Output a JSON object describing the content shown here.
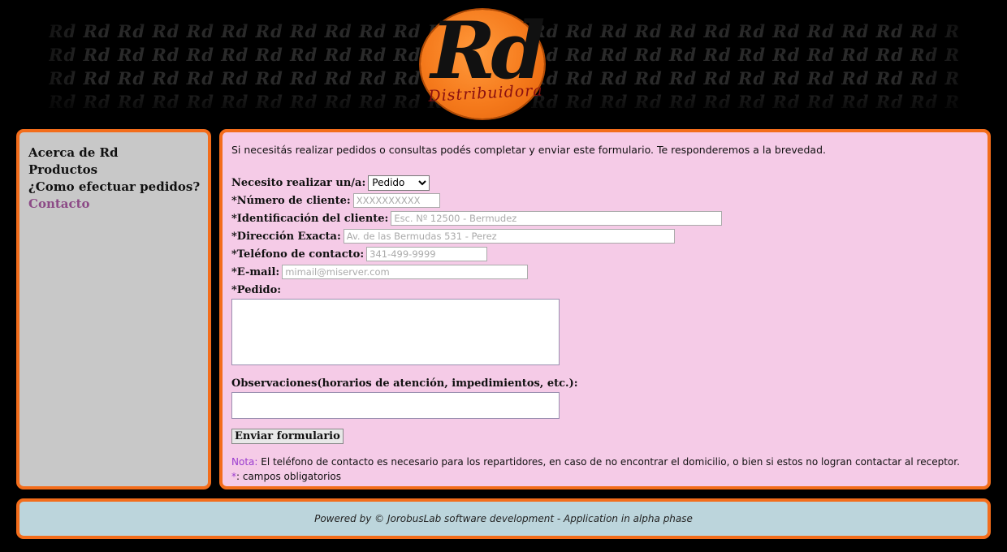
{
  "header": {
    "logo_text": "Rd",
    "logo_subtitle": "Distribuidora",
    "pattern_word": "Rd"
  },
  "sidebar": {
    "items": [
      {
        "label": "Acerca de Rd"
      },
      {
        "label": "Productos"
      },
      {
        "label": "¿Como efectuar pedidos?"
      },
      {
        "label": "Contacto"
      }
    ],
    "active_color": "#8c4a86"
  },
  "form": {
    "intro": "Si necesitás realizar pedidos o consultas podés completar y enviar este formulario. Te responderemos a la brevedad.",
    "tipo_label": "Necesito realizar un/a:",
    "tipo_value": "Pedido",
    "cliente_label": "*Número de cliente:",
    "cliente_placeholder": "XXXXXXXXXX",
    "identificacion_label": "*Identificación del cliente:",
    "identificacion_placeholder": "Esc. Nº 12500 - Bermudez",
    "direccion_label": "*Dirección Exacta:",
    "direccion_placeholder": "Av. de las Bermudas 531 - Perez",
    "telefono_label": "*Teléfono de contacto:",
    "telefono_placeholder": "341-499-9999",
    "email_label": "*E-mail:",
    "email_placeholder": "mimail@miserver.com",
    "pedido_label": "*Pedido:",
    "observaciones_label": "Observaciones(horarios de atención, impedimientos, etc.):",
    "submit_label": "Enviar formulario",
    "note_prefix": "Nota:",
    "note_text": " El teléfono de contacto es necesario para los repartidores, en caso de no encontrar el domicilio, o bien si estos no logran contactar al receptor.",
    "req_prefix": "*",
    "req_text": ": campos obligatorios"
  },
  "footer": {
    "text": "Powered by © JorobusLab software development - Application in alpha phase"
  },
  "colors": {
    "accent": "#f36d1b",
    "sidebar_bg": "#c8c8c8",
    "main_bg": "#f5cbe7",
    "footer_bg": "#bcd5dc",
    "note_mark": "#9a3ccf"
  }
}
